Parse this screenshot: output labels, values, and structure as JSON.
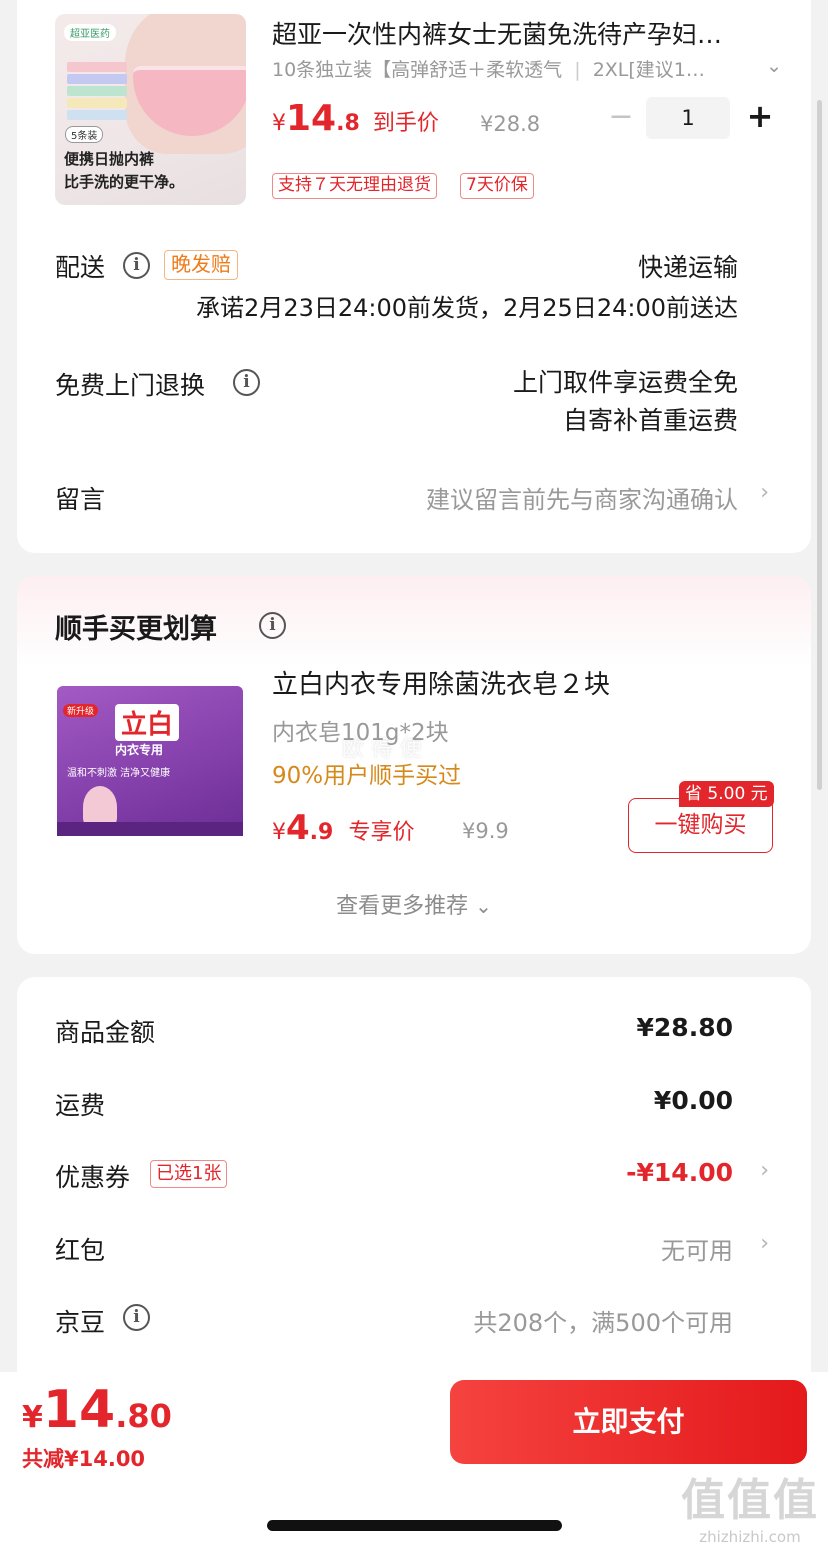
{
  "product": {
    "image_badge": "5条装",
    "image_brand": "超亚医药",
    "image_slogan_1": "便携日抛内裤",
    "image_slogan_2": "比手洗的更干净。",
    "title": "超亚一次性内裤女士无菌免洗待产孕妇…",
    "spec": "10条独立装【高弹舒适＋柔软透气",
    "size": "2XL[建议1…",
    "price_symbol": "¥",
    "price_int": "14",
    "price_dec": ".8",
    "price_tag": "到手价",
    "original_price": "¥28.8",
    "quantity": "1",
    "tags": [
      "支持７天无理由退货",
      "7天价保"
    ]
  },
  "delivery": {
    "label": "配送",
    "badge": "晚发赔",
    "method": "快递运输",
    "promise": "承诺2月23日24:00前发货，2月25日24:00前送达"
  },
  "returns": {
    "label": "免费上门退换",
    "line1": "上门取件享运费全免",
    "line2": "自寄补首重运费"
  },
  "message": {
    "label": "留言",
    "placeholder": "建议留言前先与商家沟通确认"
  },
  "addon": {
    "section_title": "顺手买更划算",
    "title": "立白内衣专用除菌洗衣皂２块",
    "spec": "内衣皂101g*2块",
    "social_proof": "90%用户顺手买过",
    "price_symbol": "¥",
    "price_int": "4",
    "price_dec": ".9",
    "price_tag": "专享价",
    "original_price": "¥9.9",
    "save_badge": "省 5.00 元",
    "buy_button": "一键购买",
    "more": "查看更多推荐",
    "image_brand": "立白",
    "image_sub": "内衣专用",
    "image_new": "新升级",
    "image_desc": "温和不刺激 洁净又健康",
    "watermark": "欧  得  便"
  },
  "summary": {
    "goods_label": "商品金额",
    "goods_value": "¥28.80",
    "shipping_label": "运费",
    "shipping_value": "¥0.00",
    "coupon_label": "优惠券",
    "coupon_badge": "已选1张",
    "coupon_value": "-¥14.00",
    "redpack_label": "红包",
    "redpack_value": "无可用",
    "bean_label": "京豆",
    "bean_value": "共208个，满500个可用"
  },
  "footer": {
    "price_symbol": "¥",
    "price_int": "14",
    "price_dec": ".80",
    "discount": "共减¥14.00",
    "pay_button": "立即支付"
  },
  "watermark": {
    "site_cn": "值值值",
    "site_en": "zhizhizhi.com"
  },
  "colors": {
    "accent_red": "#e3262b",
    "orange": "#ee7c1b",
    "pay_gradient_start": "#f5433f",
    "pay_gradient_end": "#e4191c"
  }
}
